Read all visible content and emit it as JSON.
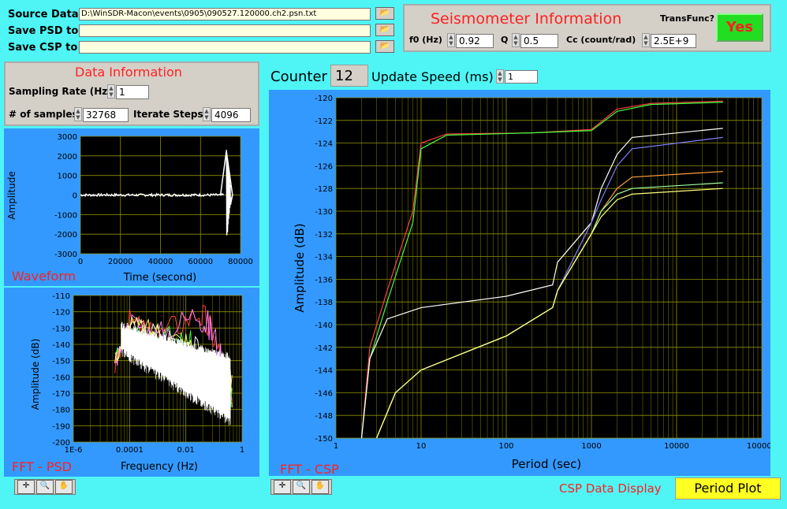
{
  "files": {
    "source_label": "Source Data",
    "source_path": "D:\\WinSDR-Macon\\events\\0905\\090527.120000.ch2.psn.txt",
    "psd_label": "Save PSD to",
    "psd_path": "",
    "csp_label": "Save CSP to",
    "csp_path": ""
  },
  "seismometer": {
    "title": "Seismometer Information",
    "f0_label": "f0 (Hz)",
    "f0_value": "0.92",
    "q_label": "Q",
    "q_value": "0.5",
    "cc_label": "Cc (count/rad)",
    "cc_value": "2.5E+9",
    "transfunc_label": "TransFunc?",
    "transfunc_button": "Yes"
  },
  "data_info": {
    "title": "Data Information",
    "rate_label": "Sampling Rate (Hz)",
    "rate_value": "1",
    "samples_label": "# of samples",
    "samples_value": "32768",
    "iterate_label": "Iterate Steps",
    "iterate_value": "4096"
  },
  "counter": {
    "label": "Counter",
    "value": "12",
    "speed_label": "Update Speed (ms)",
    "speed_value": "1"
  },
  "waveform": {
    "name": "Waveform",
    "ylabel": "Amplitude",
    "xlabel": "Time (second)",
    "yticks": [
      "3000",
      "2000",
      "1000",
      "0",
      "-1000",
      "-2000",
      "-3000"
    ],
    "xticks": [
      "0",
      "20000",
      "40000",
      "60000",
      "80000"
    ]
  },
  "psd": {
    "name": "FFT - PSD",
    "ylabel": "Amplitude (dB)",
    "xlabel": "Frequency (Hz)",
    "yticks": [
      "-110",
      "-120",
      "-130",
      "-140",
      "-150",
      "-160",
      "-170",
      "-180",
      "-190",
      "-200"
    ],
    "xticks": [
      "1E-6",
      "0.0001",
      "0.01",
      "1"
    ]
  },
  "csp": {
    "name": "FFT - CSP",
    "ylabel": "Amplitude (dB)",
    "xlabel": "Period (sec)",
    "yticks": [
      "-120",
      "-122",
      "-124",
      "-126",
      "-128",
      "-130",
      "-132",
      "-134",
      "-136",
      "-138",
      "-140",
      "-142",
      "-144",
      "-146",
      "-148",
      "-150"
    ],
    "xticks": [
      "1",
      "10",
      "100",
      "1000",
      "10000",
      "100000"
    ]
  },
  "display": {
    "label": "CSP Data Display",
    "value": "Period Plot"
  },
  "colors": {
    "background": "#4ff5f5",
    "chart_panel": "#3399ff",
    "plot_bg": "#000000",
    "grid": "#808000",
    "title_red": "#ff2020",
    "yes_green": "#22dd22"
  },
  "chart_data": [
    {
      "type": "line",
      "name": "Waveform",
      "xlabel": "Time (second)",
      "ylabel": "Amplitude",
      "xlim": [
        0,
        80000
      ],
      "ylim": [
        -3000,
        3000
      ],
      "series": [
        {
          "values": [
            [
              0,
              0
            ],
            [
              70000,
              0
            ],
            [
              73000,
              2300
            ],
            [
              73500,
              -1900
            ],
            [
              74000,
              1200
            ],
            [
              75000,
              -500
            ],
            [
              76000,
              0
            ]
          ]
        }
      ]
    },
    {
      "type": "line",
      "name": "FFT - PSD",
      "xlabel": "Frequency (Hz)",
      "ylabel": "Amplitude (dB)",
      "log_x": true,
      "xlim": [
        1e-06,
        1
      ],
      "ylim": [
        -200,
        -110
      ],
      "series": [
        {
          "values": [
            [
              3e-05,
              -150
            ],
            [
              0.0001,
              -128
            ],
            [
              0.001,
              -133
            ],
            [
              0.01,
              -140
            ],
            [
              0.1,
              -155
            ],
            [
              0.5,
              -170
            ]
          ]
        },
        {
          "values": [
            [
              3e-05,
              -155
            ],
            [
              0.0001,
              -125
            ],
            [
              0.001,
              -135
            ],
            [
              0.03,
              -120
            ],
            [
              0.1,
              -135
            ],
            [
              0.5,
              -180
            ]
          ]
        }
      ]
    },
    {
      "type": "line",
      "name": "FFT - CSP",
      "xlabel": "Period (sec)",
      "ylabel": "Amplitude (dB)",
      "log_x": true,
      "xlim": [
        1,
        100000
      ],
      "ylim": [
        -150,
        -120
      ],
      "series": [
        {
          "color": "#ff4040",
          "values": [
            [
              2,
              -150
            ],
            [
              2.5,
              -142
            ],
            [
              4,
              -137
            ],
            [
              8,
              -130
            ],
            [
              10,
              -124
            ],
            [
              20,
              -123.2
            ],
            [
              200,
              -123.1
            ],
            [
              1000,
              -122.8
            ],
            [
              2000,
              -121
            ],
            [
              5000,
              -120.5
            ],
            [
              35000,
              -120.3
            ]
          ]
        },
        {
          "color": "#40ff40",
          "values": [
            [
              2,
              -150
            ],
            [
              2.5,
              -143
            ],
            [
              4,
              -138
            ],
            [
              8,
              -131
            ],
            [
              10,
              -124.5
            ],
            [
              20,
              -123.3
            ],
            [
              200,
              -123.1
            ],
            [
              1000,
              -122.9
            ],
            [
              2000,
              -121.2
            ],
            [
              5000,
              -120.6
            ],
            [
              35000,
              -120.4
            ]
          ]
        },
        {
          "color": "#ffffff",
          "values": [
            [
              2,
              -150
            ],
            [
              2.5,
              -143
            ],
            [
              4,
              -139.5
            ],
            [
              10,
              -138.5
            ],
            [
              100,
              -137.5
            ],
            [
              350,
              -136.5
            ],
            [
              400,
              -134.5
            ],
            [
              1000,
              -131
            ],
            [
              1300,
              -128
            ],
            [
              2000,
              -125
            ],
            [
              3000,
              -123.5
            ],
            [
              35000,
              -122.7
            ]
          ]
        },
        {
          "color": "#8080ff",
          "values": [
            [
              3,
              -150
            ],
            [
              5,
              -146
            ],
            [
              10,
              -144
            ],
            [
              100,
              -141
            ],
            [
              350,
              -138.5
            ],
            [
              400,
              -137
            ],
            [
              1000,
              -131
            ],
            [
              1300,
              -129
            ],
            [
              2000,
              -126
            ],
            [
              3000,
              -124.5
            ],
            [
              35000,
              -123.5
            ]
          ]
        },
        {
          "color": "#ffa040",
          "values": [
            [
              3,
              -150
            ],
            [
              5,
              -146
            ],
            [
              10,
              -144
            ],
            [
              100,
              -141
            ],
            [
              350,
              -138.5
            ],
            [
              400,
              -137
            ],
            [
              1000,
              -132
            ],
            [
              1300,
              -130
            ],
            [
              2000,
              -128
            ],
            [
              3000,
              -127
            ],
            [
              35000,
              -126.5
            ]
          ]
        },
        {
          "color": "#a0ffa0",
          "values": [
            [
              3,
              -150
            ],
            [
              5,
              -146
            ],
            [
              10,
              -144
            ],
            [
              100,
              -141
            ],
            [
              350,
              -138.5
            ],
            [
              400,
              -137
            ],
            [
              1000,
              -132
            ],
            [
              1300,
              -130
            ],
            [
              2000,
              -128.5
            ],
            [
              3000,
              -128
            ],
            [
              35000,
              -127.5
            ]
          ]
        },
        {
          "color": "#ffff80",
          "values": [
            [
              3,
              -150
            ],
            [
              5,
              -146
            ],
            [
              10,
              -144
            ],
            [
              100,
              -141
            ],
            [
              350,
              -138.5
            ],
            [
              400,
              -137
            ],
            [
              1000,
              -132
            ],
            [
              1300,
              -130.5
            ],
            [
              2000,
              -129
            ],
            [
              3000,
              -128.5
            ],
            [
              35000,
              -128
            ]
          ]
        }
      ]
    }
  ]
}
